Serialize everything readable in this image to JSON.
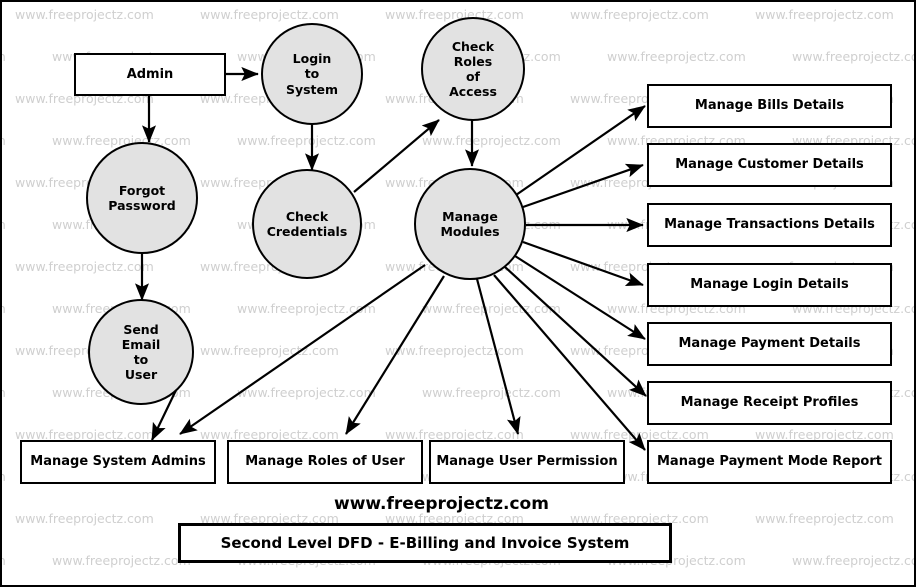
{
  "diagram": {
    "title": "Second Level DFD - E-Billing and Invoice System",
    "site_text": "www.freeprojectz.com",
    "watermark_text": "www.freeprojectz.com",
    "colors": {
      "process_fill": "#e2e2e2",
      "stroke": "#000000",
      "background": "#ffffff",
      "watermark": "#cfcfcf"
    }
  },
  "entities": [
    {
      "id": "admin",
      "label": "Admin"
    }
  ],
  "processes": [
    {
      "id": "login_to_system",
      "label": "Login\nto\nSystem"
    },
    {
      "id": "check_roles",
      "label": "Check\nRoles\nof\nAccess"
    },
    {
      "id": "forgot_password",
      "label": "Forgot\nPassword"
    },
    {
      "id": "check_credentials",
      "label": "Check\nCredentials"
    },
    {
      "id": "manage_modules",
      "label": "Manage\nModules"
    },
    {
      "id": "send_email",
      "label": "Send\nEmail\nto\nUser"
    }
  ],
  "data_stores_right": [
    {
      "id": "bills",
      "label": "Manage Bills Details"
    },
    {
      "id": "customer",
      "label": "Manage Customer Details"
    },
    {
      "id": "transactions",
      "label": "Manage Transactions Details"
    },
    {
      "id": "login",
      "label": "Manage Login Details"
    },
    {
      "id": "payment",
      "label": "Manage Payment Details"
    },
    {
      "id": "receipt",
      "label": "Manage Receipt Profiles"
    },
    {
      "id": "payment_mode",
      "label": "Manage Payment Mode Report"
    }
  ],
  "data_stores_bottom": [
    {
      "id": "system_admins",
      "label": "Manage System Admins"
    },
    {
      "id": "roles_of_user",
      "label": "Manage Roles of User"
    },
    {
      "id": "user_permission",
      "label": "Manage User Permission"
    }
  ],
  "flows": [
    {
      "from": "admin",
      "to": "login_to_system"
    },
    {
      "from": "admin",
      "to": "forgot_password"
    },
    {
      "from": "login_to_system",
      "to": "check_credentials"
    },
    {
      "from": "check_credentials",
      "to": "check_roles"
    },
    {
      "from": "check_roles",
      "to": "manage_modules"
    },
    {
      "from": "forgot_password",
      "to": "send_email"
    },
    {
      "from": "send_email",
      "to": "system_admins"
    },
    {
      "from": "manage_modules",
      "to": "bills"
    },
    {
      "from": "manage_modules",
      "to": "customer"
    },
    {
      "from": "manage_modules",
      "to": "transactions"
    },
    {
      "from": "manage_modules",
      "to": "login"
    },
    {
      "from": "manage_modules",
      "to": "payment"
    },
    {
      "from": "manage_modules",
      "to": "receipt"
    },
    {
      "from": "manage_modules",
      "to": "payment_mode"
    },
    {
      "from": "manage_modules",
      "to": "system_admins"
    },
    {
      "from": "manage_modules",
      "to": "roles_of_user"
    },
    {
      "from": "manage_modules",
      "to": "user_permission"
    }
  ]
}
